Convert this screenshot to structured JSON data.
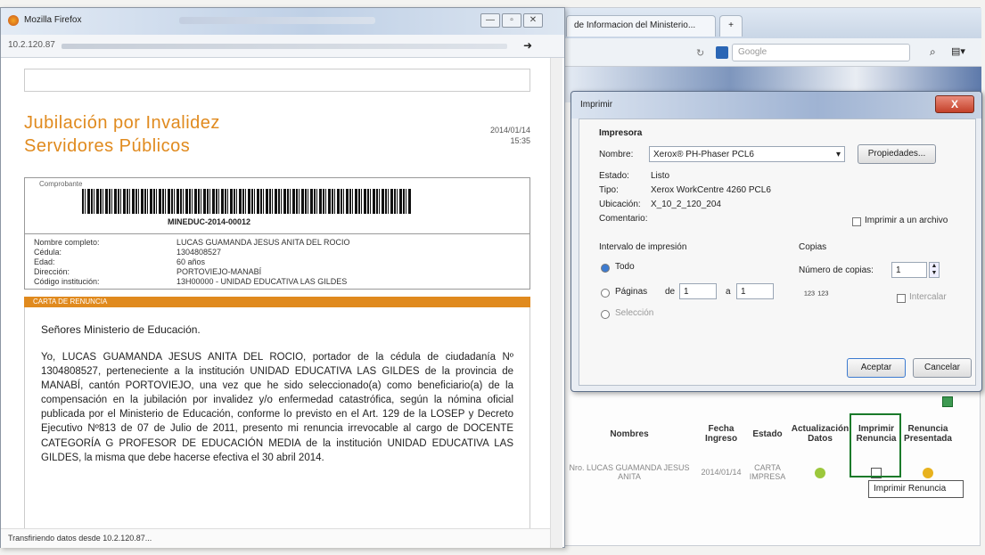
{
  "background_browser": {
    "tab_label": "de Informacion del Ministerio...",
    "new_tab": "+",
    "search_placeholder": "Google",
    "table": {
      "headers": [
        "Nombres",
        "Fecha Ingreso",
        "Estado",
        "Actualización Datos",
        "Imprimir Renuncia",
        "Renuncia Presentada"
      ],
      "row": {
        "nombres": "Nro. LUCAS GUAMANDA JESUS ANITA",
        "fecha": "2014/01/14",
        "estado": "CARTA IMPRESA"
      },
      "tooltip": "Imprimir Renuncia"
    }
  },
  "print_dialog": {
    "title": "Imprimir",
    "close": "X",
    "section_printer": "Impresora",
    "name_label": "Nombre:",
    "printer_name": "Xerox® PH-Phaser PCL6",
    "properties_btn": "Propiedades...",
    "status_label": "Estado:",
    "status_value": "Listo",
    "type_label": "Tipo:",
    "type_value": "Xerox WorkCentre 4260 PCL6",
    "location_label": "Ubicación:",
    "location_value": "X_10_2_120_204",
    "comment_label": "Comentario:",
    "print_to_file": "Imprimir a un archivo",
    "range_title": "Intervalo de impresión",
    "range_all": "Todo",
    "range_pages": "Páginas",
    "pages_from_label": "de",
    "pages_from": "1",
    "pages_to_label": "a",
    "pages_to": "1",
    "range_selection": "Selección",
    "copies_title": "Copias",
    "copies_label": "Número de copias:",
    "copies_value": "1",
    "collate": "Intercalar",
    "accept_btn": "Aceptar",
    "cancel_btn": "Cancelar"
  },
  "popup": {
    "window_title": "Mozilla Firefox",
    "url": "10.2.120.87",
    "doc_title_line1": "Jubilación por Invalidez",
    "doc_title_line2": "Servidores Públicos",
    "date": "2014/01/14",
    "time": "15:35",
    "barcode_label": "Comprobante",
    "barcode_text": "MINEDUC-2014-00012",
    "info": [
      {
        "label": "Nombre completo:",
        "value": "LUCAS GUAMANDA JESUS ANITA DEL ROCIO"
      },
      {
        "label": "Cédula:",
        "value": "1304808527"
      },
      {
        "label": "Edad:",
        "value": "60 años"
      },
      {
        "label": "Dirección:",
        "value": "PORTOVIEJO-MANABÍ"
      },
      {
        "label": "Código institución:",
        "value": "13H00000 - UNIDAD EDUCATIVA LAS GILDES"
      }
    ],
    "band_label": "CARTA DE RENUNCIA",
    "greeting": "Señores Ministerio de Educación.",
    "letter": "Yo, LUCAS GUAMANDA JESUS ANITA DEL ROCIO, portador de la cédula de ciudadanía Nº 1304808527, perteneciente a la institución UNIDAD EDUCATIVA LAS GILDES de la provincia de MANABÍ, cantón PORTOVIEJO, una vez que he sido seleccionado(a) como beneficiario(a) de la compensación en la jubilación por invalidez y/o enfermedad catastrófica, según la nómina oficial publicada por el Ministerio de Educación, conforme lo previsto en el Art. 129 de la LOSEP y Decreto Ejecutivo Nº813 de 07 de Julio de 2011, presento mi renuncia irrevocable al cargo de DOCENTE CATEGORÍA G PROFESOR DE EDUCACIÓN MEDIA de la institución UNIDAD EDUCATIVA LAS GILDES, la misma que debe hacerse efectiva el 30 abril 2014.",
    "status": "Transfiriendo datos desde 10.2.120.87..."
  }
}
